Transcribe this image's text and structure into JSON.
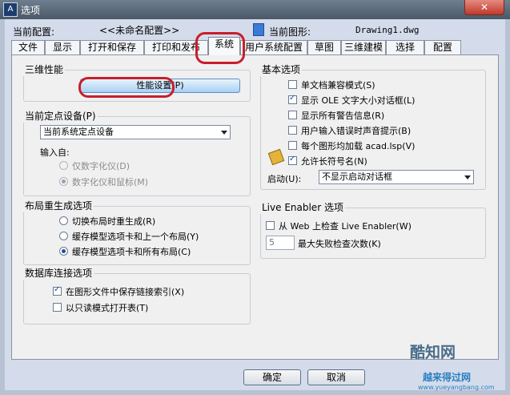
{
  "window": {
    "title": "选项",
    "close_symbol": "✕"
  },
  "config": {
    "current_config_label": "当前配置:",
    "current_config_value": "<<未命名配置>>",
    "current_drawing_label": "当前图形:",
    "current_drawing_value": "Drawing1.dwg"
  },
  "tabs": [
    "文件",
    "显示",
    "打开和保存",
    "打印和发布",
    "系统",
    "用户系统配置",
    "草图",
    "三维建模",
    "选择",
    "配置"
  ],
  "active_tab": "系统",
  "perf": {
    "title": "三维性能",
    "button": "性能设置(P)"
  },
  "pointing": {
    "title": "当前定点设备(P)",
    "device": "当前系统定点设备",
    "input_from": "输入自:",
    "opt1": "仅数字化仪(D)",
    "opt2": "数字化仪和鼠标(M)"
  },
  "layout_regen": {
    "title": "布局重生成选项",
    "opt1": "切换布局时重生成(R)",
    "opt2": "缓存模型选项卡和上一个布局(Y)",
    "opt3": "缓存模型选项卡和所有布局(C)"
  },
  "db": {
    "title": "数据库连接选项",
    "opt1": "在图形文件中保存链接索引(X)",
    "opt2": "以只读模式打开表(T)"
  },
  "general": {
    "title": "基本选项",
    "opt1": "单文档兼容模式(S)",
    "opt2": "显示 OLE 文字大小对话框(L)",
    "opt3": "显示所有警告信息(R)",
    "opt4": "用户输入错误时声音提示(B)",
    "opt5": "每个图形均加载 acad.lsp(V)",
    "opt6": "允许长符号名(N)",
    "startup_label": "启动(U):",
    "startup_value": "不显示启动对话框"
  },
  "live": {
    "title": "Live Enabler 选项",
    "check": "从 Web 上检查 Live Enabler(W)",
    "max_value": "5",
    "max_label": "最大失败检查次数(K)"
  },
  "buttons": {
    "ok": "确定",
    "cancel": "取消"
  },
  "watermarks": {
    "w1": "酷知网",
    "w2": "越来得过网",
    "w3": "www.yueyangbang.com"
  },
  "colors": {
    "highlight_red": "#c81e2b",
    "button_blue": "#a9d0f3"
  }
}
